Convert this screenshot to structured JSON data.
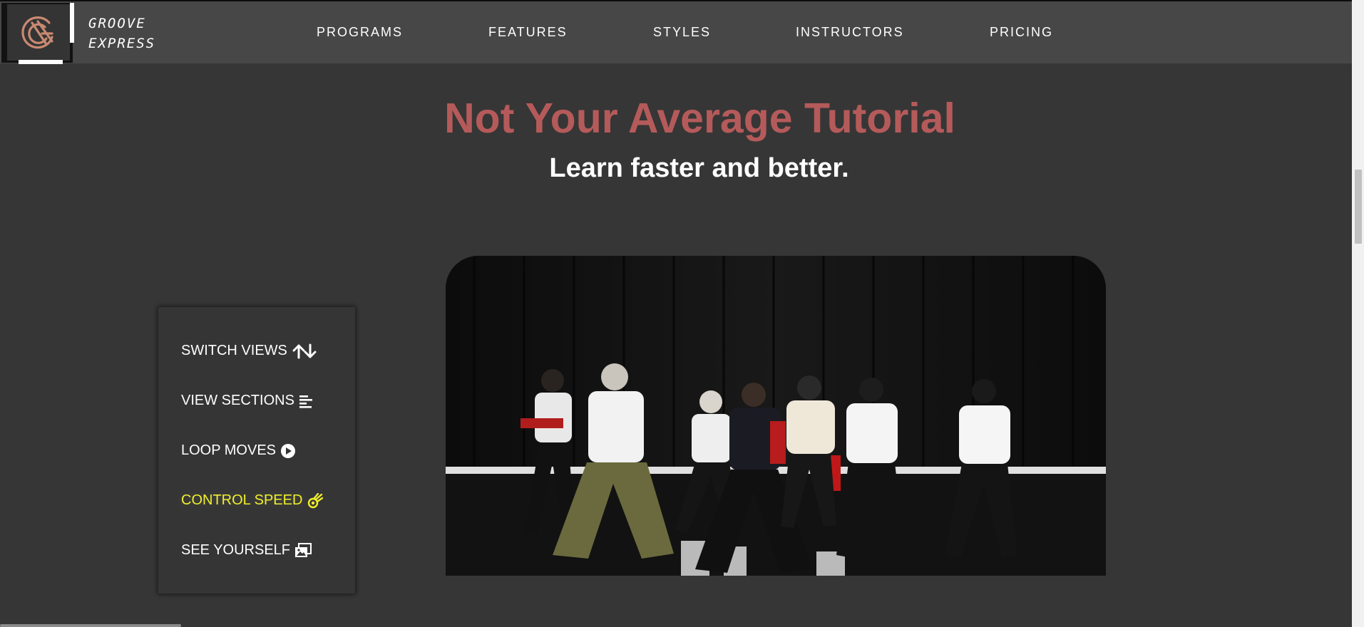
{
  "brand": {
    "line1": "GROOVE",
    "line2": "EXPRESS"
  },
  "nav": [
    {
      "label": "PROGRAMS"
    },
    {
      "label": "FEATURES"
    },
    {
      "label": "STYLES"
    },
    {
      "label": "INSTRUCTORS"
    },
    {
      "label": "PRICING"
    }
  ],
  "hero": {
    "title": "Not Your Average Tutorial",
    "subtitle": "Learn faster and better."
  },
  "features": [
    {
      "label": "SWITCH VIEWS",
      "icon": "up-down-arrows-icon"
    },
    {
      "label": "VIEW SECTIONS",
      "icon": "align-left-lines-icon"
    },
    {
      "label": "LOOP MOVES",
      "icon": "play-circle-icon"
    },
    {
      "label": "CONTROL SPEED",
      "icon": "meteor-icon",
      "active": true
    },
    {
      "label": "SEE YOURSELF",
      "icon": "photo-gallery-icon"
    }
  ],
  "colors": {
    "title": "#b55a5a",
    "active_feature": "#f0ef2a",
    "background": "#363636",
    "navbar": "#474747"
  }
}
